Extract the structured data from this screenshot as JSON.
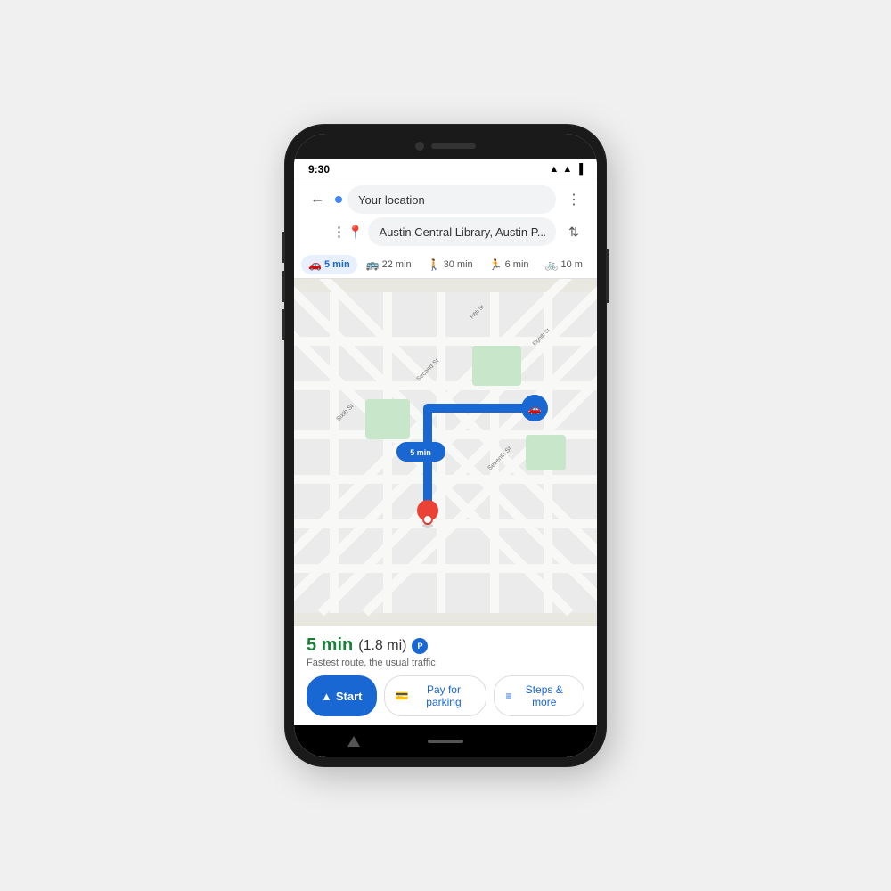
{
  "status_bar": {
    "time": "9:30"
  },
  "nav": {
    "origin": "Your location",
    "destination": "Austin Central Library, Austin P...",
    "more_icon": "⋮",
    "swap_icon": "⇅",
    "back_icon": "←"
  },
  "transport_tabs": [
    {
      "icon": "🚗",
      "label": "5 min",
      "active": true
    },
    {
      "icon": "🚌",
      "label": "22 min",
      "active": false
    },
    {
      "icon": "🚶",
      "label": "30 min",
      "active": false
    },
    {
      "icon": "🏃",
      "label": "6 min",
      "active": false
    },
    {
      "icon": "🚲",
      "label": "10 m",
      "active": false
    }
  ],
  "route": {
    "time": "5 min",
    "distance": "(1.8 mi)",
    "description": "Fastest route, the usual traffic"
  },
  "buttons": {
    "start": "Start",
    "pay_parking": "Pay for parking",
    "steps_more": "Steps & more"
  },
  "map": {
    "route_label": "5 min",
    "street1": "Sixth St",
    "street2": "Second St",
    "street3": "Seventh St",
    "street4": "Eighth St",
    "street5": "Fifth St"
  }
}
